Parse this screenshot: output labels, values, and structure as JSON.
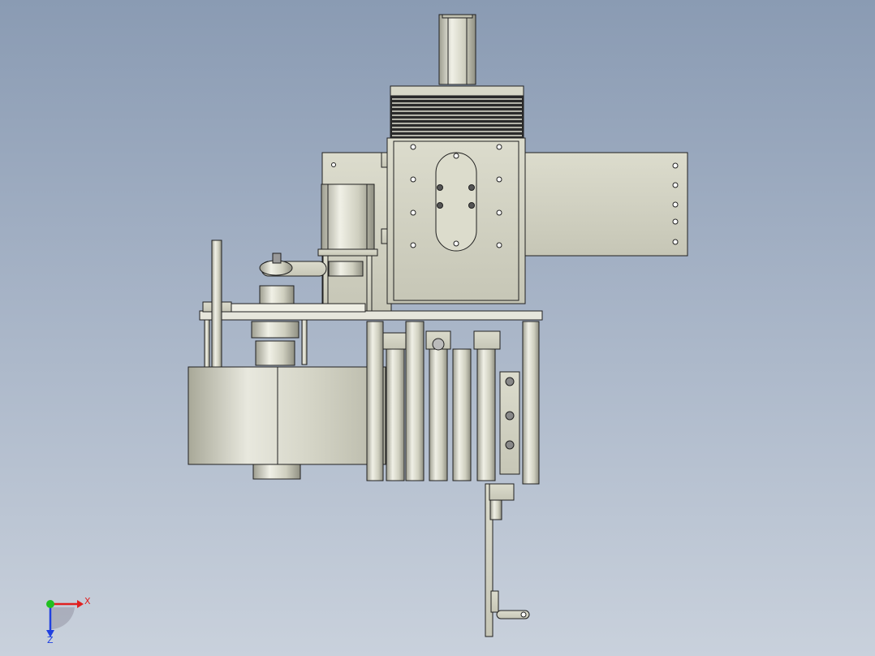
{
  "viewport": {
    "background_top": "#8a9bb3",
    "background_bottom": "#c9d1dc"
  },
  "triad": {
    "x_label": "X",
    "z_label": "Z",
    "x_color": "#e02020",
    "y_color": "#20c020",
    "z_color": "#2040e0"
  },
  "model": {
    "part_fill": "#d6d6c6",
    "part_shadow": "#b9b9a8",
    "edge_color": "#202020",
    "highlight": "#f2f2ea"
  }
}
